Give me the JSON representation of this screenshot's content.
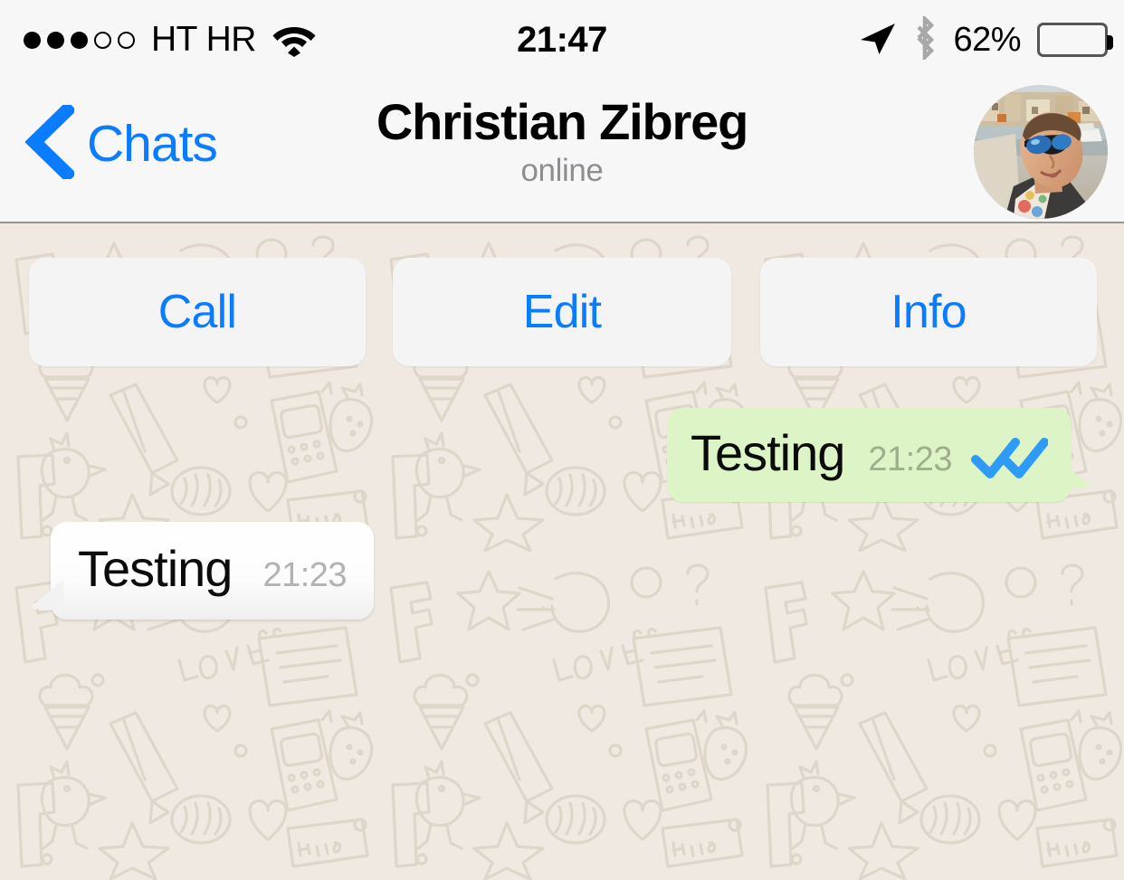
{
  "status_bar": {
    "signal_dots_filled": 3,
    "signal_dots_empty": 2,
    "carrier": "HT HR",
    "wifi_icon": "wifi-icon",
    "time": "21:47",
    "location_icon": "location-arrow-icon",
    "bluetooth_icon": "bluetooth-icon",
    "battery_percent_label": "62%",
    "battery_level": 62
  },
  "nav_bar": {
    "back_icon": "chevron-left-icon",
    "back_label": "Chats",
    "title": "Christian Zibreg",
    "subtitle": "online",
    "avatar_icon": "contact-avatar-photo"
  },
  "actions": [
    {
      "label": "Call",
      "name": "call-button"
    },
    {
      "label": "Edit",
      "name": "edit-button"
    },
    {
      "label": "Info",
      "name": "info-button"
    }
  ],
  "messages": [
    {
      "direction": "outgoing",
      "text": "Testing",
      "time": "21:23",
      "status": "read",
      "status_icon": "double-check-icon"
    },
    {
      "direction": "incoming",
      "text": "Testing",
      "time": "21:23"
    }
  ],
  "colors": {
    "accent_blue": "#0A7CFF",
    "tick_blue": "#2E9BF7",
    "outgoing_bubble": "#DDF5C6",
    "incoming_bubble": "#FFFFFF",
    "nav_background": "#F7F7F7",
    "wallpaper_background": "#EFE9E1",
    "wallpaper_doodle": "#E0D8CC",
    "subtitle_gray": "#8E8E92"
  }
}
